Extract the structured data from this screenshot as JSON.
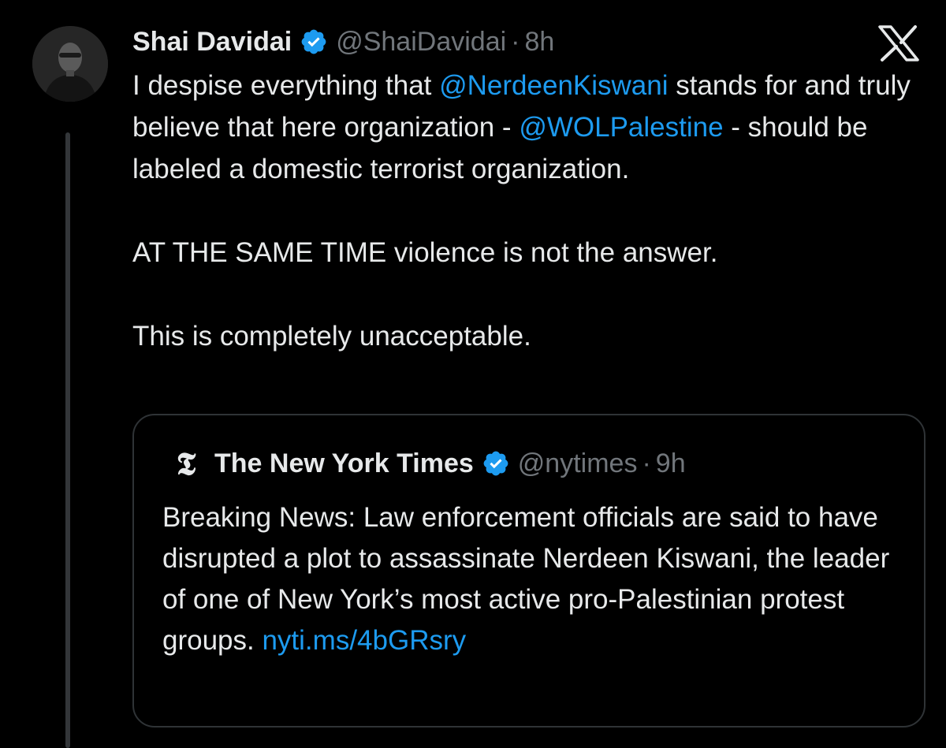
{
  "tweet": {
    "author_name": "Shai Davidai",
    "handle": "@ShaiDavidai",
    "separator": "·",
    "time": "8h",
    "avatar_icon": "user-avatar-photo",
    "verified_icon": "verified-badge-icon",
    "platform_icon": "x-logo-icon",
    "text": {
      "p1_before": "I despise everything that ",
      "p1_mention1": "@NerdeenKiswani",
      "p1_mid": " stands for and truly believe that here organization - ",
      "p1_mention2": "@WOLPalestine",
      "p1_after": " - should be labeled a domestic terrorist organization.",
      "p2": "AT THE SAME TIME violence is not the answer.",
      "p3": "This is completely unacceptable."
    }
  },
  "quote": {
    "logo_glyph": "𝕿",
    "author_name": "The New York Times",
    "handle": "@nytimes",
    "separator": "·",
    "time": "9h",
    "text": "Breaking News: Law enforcement officials are said to have disrupted a plot to assassinate Nerdeen Kiswani, the leader of one of New York’s most active pro-Palestinian protest groups. ",
    "link": "nyti.ms/4bGRsry"
  },
  "colors": {
    "background": "#000000",
    "text": "#e7e9ea",
    "secondary": "#71767b",
    "link": "#1d9bf0",
    "verified": "#1d9bf0",
    "border": "#2f3336"
  }
}
